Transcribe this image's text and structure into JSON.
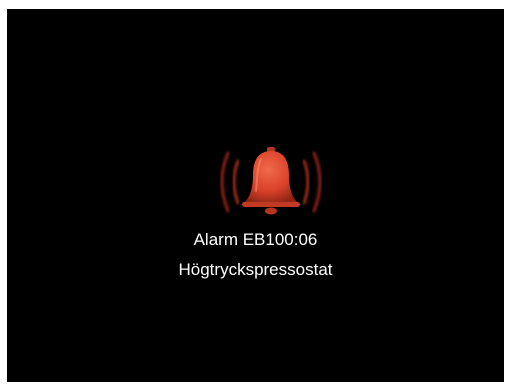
{
  "alarm": {
    "icon": "alarm-bell-icon",
    "code": "Alarm EB100:06",
    "description": "Högtryckspressostat"
  },
  "colors": {
    "background": "#000000",
    "bell": "#d9412a",
    "text": "#ffffff"
  }
}
